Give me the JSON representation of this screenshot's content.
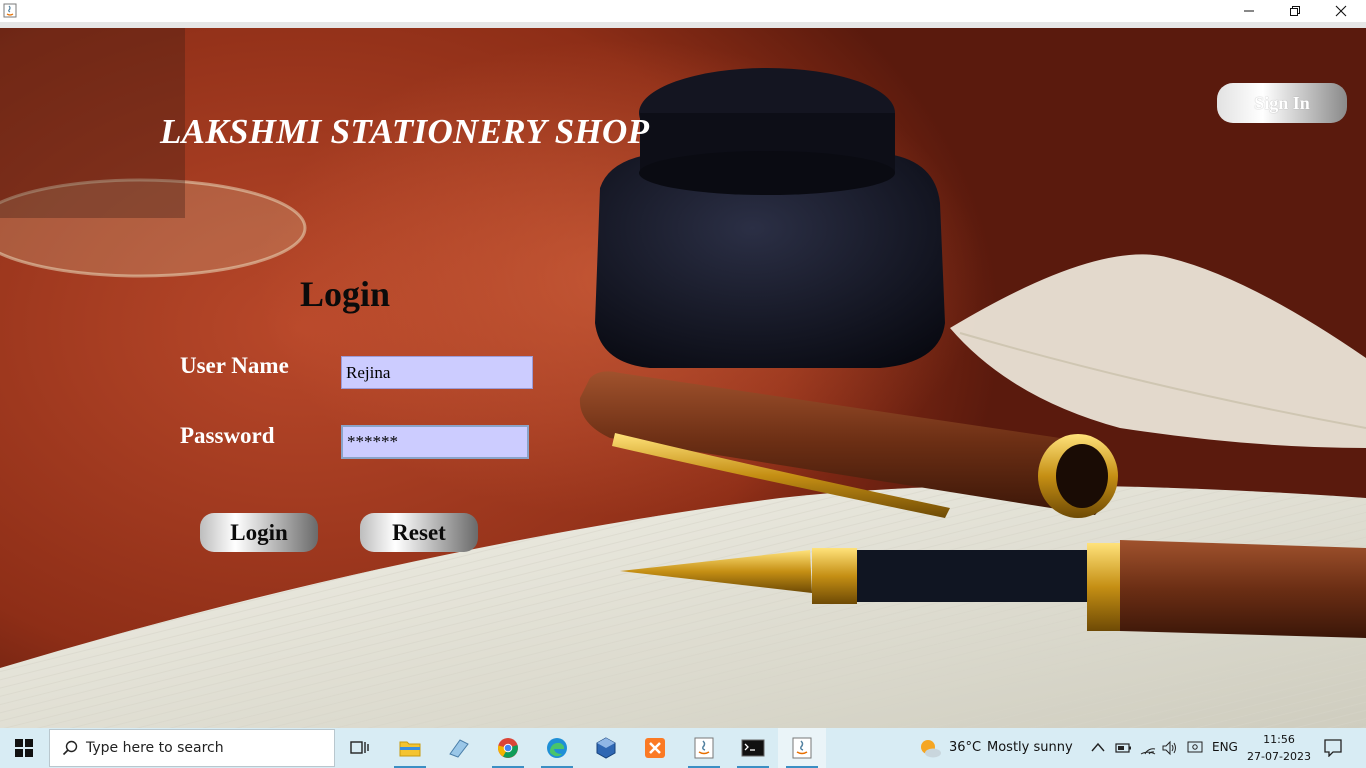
{
  "window": {
    "icons": {
      "app": "java-icon",
      "minimize": "minimize-icon",
      "maximize": "restore-icon",
      "close": "close-icon"
    }
  },
  "app": {
    "shop_title": "LAKSHMI STATIONERY SHOP",
    "sign_in_label": "Sign In",
    "login_heading": "Login",
    "username_label": "User Name",
    "username_value": "Rejina",
    "password_label": "Password",
    "password_value": "******",
    "login_button": "Login",
    "reset_button": "Reset",
    "colors": {
      "field_bg": "#ccccff",
      "title_text": "#ffffff",
      "heading_text": "#0b0b0b"
    }
  },
  "taskbar": {
    "search_placeholder": "Type here to search",
    "pinned": [
      "windows-start-icon",
      "task-view-icon",
      "file-explorer-icon",
      "paint-icon",
      "chrome-icon",
      "edge-icon",
      "virtualbox-icon",
      "xampp-icon",
      "java-icon",
      "terminal-icon",
      "java-icon"
    ],
    "weather_temp": "36°C",
    "weather_text": "Mostly sunny",
    "language": "ENG",
    "time": "11:56",
    "date": "27-07-2023",
    "colors": {
      "bar": "#d8ecf4",
      "accent": "#3b8fc4"
    }
  }
}
